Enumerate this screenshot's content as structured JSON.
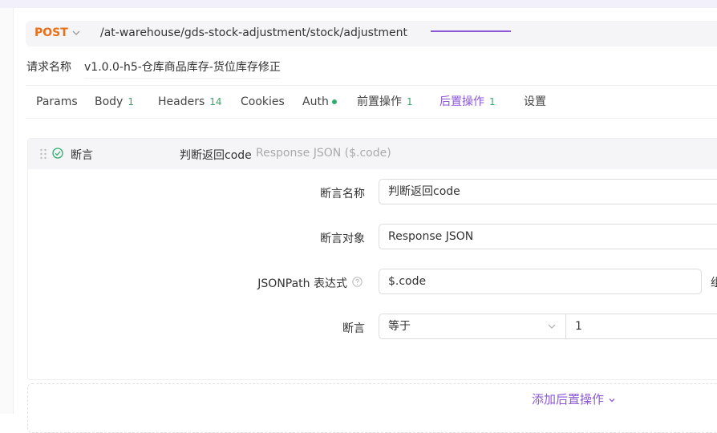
{
  "request": {
    "method": "POST",
    "url": "/at-warehouse/gds-stock-adjustment/stock/adjustment",
    "name_label": "请求名称",
    "name_value": "v1.0.0-h5-仓库商品库存-货位库存修正"
  },
  "tabs": [
    {
      "label": "Params"
    },
    {
      "label": "Body",
      "count": "1"
    },
    {
      "label": "Headers",
      "count": "14"
    },
    {
      "label": "Cookies"
    },
    {
      "label": "Auth",
      "status": "dot"
    },
    {
      "label": "前置操作",
      "count": "1"
    },
    {
      "label": "后置操作",
      "count": "1",
      "active": true
    },
    {
      "label": "设置"
    }
  ],
  "assertion": {
    "title": "断言",
    "name": "判断返回code",
    "desc": "Response JSON ($.code)",
    "fields": {
      "name_label": "断言名称",
      "name_value": "判断返回code",
      "object_label": "断言对象",
      "object_value": "Response JSON",
      "jsonpath_label": "JSONPath 表达式",
      "jsonpath_value": "$.code",
      "assert_label": "断言",
      "operator_value": "等于",
      "expected_value": "1"
    },
    "right_cut_text": "组"
  },
  "add_post_action": "添加后置操作",
  "colors": {
    "accent": "#8c57d6",
    "method": "#e8701a",
    "count_green": "#3aa66a"
  }
}
